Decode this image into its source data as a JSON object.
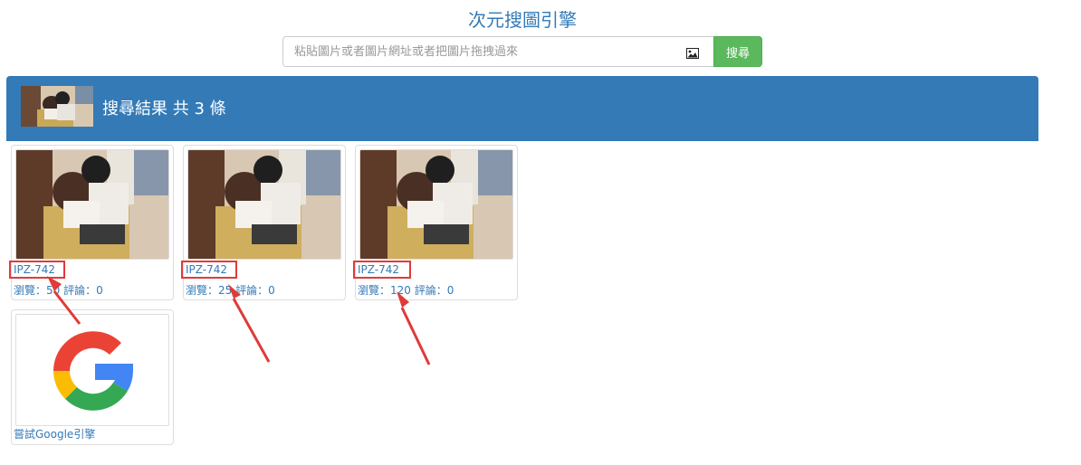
{
  "header": {
    "title": "次元搜圖引擎"
  },
  "search": {
    "placeholder": "粘貼圖片或者圖片網址或者把圖片拖拽過來",
    "button_label": "搜尋",
    "image_icon": "image-icon"
  },
  "results": {
    "title": "搜尋結果 共 3 條",
    "items": [
      {
        "code": "IPZ-742",
        "stats": "瀏覽：50 評論：0"
      },
      {
        "code": "IPZ-742",
        "stats": "瀏覽：25 評論：0"
      },
      {
        "code": "IPZ-742",
        "stats": "瀏覽：120 評論：0"
      }
    ],
    "google": {
      "label": "嘗試Google引擎",
      "icon": "google-logo"
    }
  },
  "colors": {
    "primary": "#337ab7",
    "button": "#5cb85c",
    "annotation": "#e03a3a"
  }
}
